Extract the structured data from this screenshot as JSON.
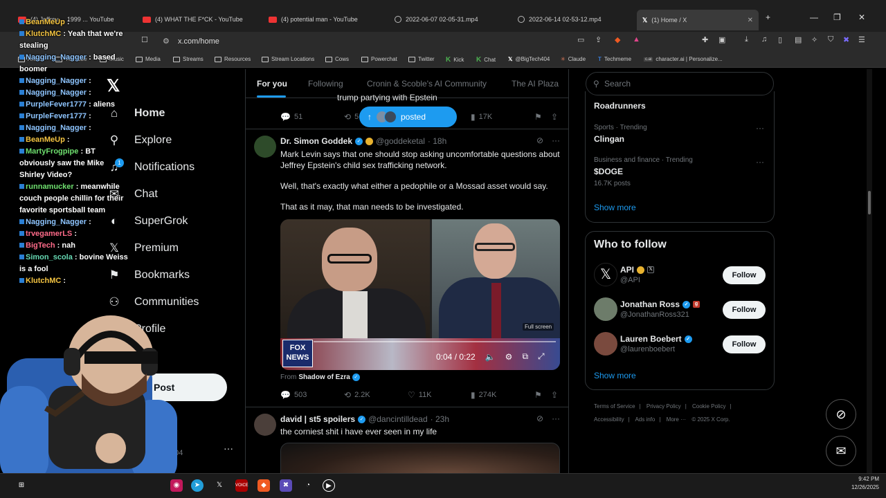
{
  "browser": {
    "tabs": [
      {
        "title": "(4) Jeffrey ... 1999 ... YouTube",
        "kind": "youtube"
      },
      {
        "title": "(4) WHAT THE F*CK - YouTube",
        "kind": "youtube"
      },
      {
        "title": "(4) potential man - YouTube",
        "kind": "youtube"
      },
      {
        "title": "2022-06-07 02-05-31.mp4",
        "kind": "video"
      },
      {
        "title": "2022-06-14 02-53-12.mp4",
        "kind": "video"
      },
      {
        "title": "(1) Home / X",
        "kind": "x",
        "active": true
      }
    ],
    "url": "x.com/home",
    "bookmarks": [
      "Artists",
      "YouTube",
      "Music",
      "Media",
      "Streams",
      "Resources",
      "Stream Locations",
      "Cows",
      "Powerchat",
      "Twitter",
      "Kick",
      "Chat",
      "@BigTech404",
      "Claude",
      "Techmeme",
      "character.ai | Personalize..."
    ]
  },
  "chat_overlay": [
    {
      "user": "BeanMeUp",
      "msg": "",
      "color": "u1"
    },
    {
      "user": "KlutchMC",
      "msg": "Yeah that we're stealing",
      "color": "u1"
    },
    {
      "user": "Nagging_Nagger",
      "msg": "based boomer",
      "color": "u2"
    },
    {
      "user": "Nagging_Nagger",
      "msg": "",
      "color": "u2"
    },
    {
      "user": "Nagging_Nagger",
      "msg": "",
      "color": "u2"
    },
    {
      "user": "PurpleFever1777",
      "msg": "aliens",
      "color": "u2"
    },
    {
      "user": "PurpleFever1777",
      "msg": "",
      "color": "u2"
    },
    {
      "user": "Nagging_Nagger",
      "msg": "",
      "color": "u2"
    },
    {
      "user": "BeanMeUp",
      "msg": "",
      "color": "u1"
    },
    {
      "user": "MartyFrogpipe",
      "msg": "BT obviously saw the Mike Shirley Video?",
      "color": "u3"
    },
    {
      "user": "runnamucker",
      "msg": "meanwhile couch people chillin for their favorite sportsball team",
      "color": "u3"
    },
    {
      "user": "Nagging_Nagger",
      "msg": "",
      "color": "u2"
    },
    {
      "user": "trvegamerLS",
      "msg": "",
      "color": "u4"
    },
    {
      "user": "BigTech",
      "msg": "nah",
      "color": "u4"
    },
    {
      "user": "Simon_scola",
      "msg": "bovine Weiss is a fool",
      "color": "u6"
    },
    {
      "user": "KlutchMC",
      "msg": "",
      "color": "u1"
    }
  ],
  "nav": {
    "items": [
      {
        "label": "Home",
        "icon": "home-icon"
      },
      {
        "label": "Explore",
        "icon": "search-icon"
      },
      {
        "label": "Notifications",
        "icon": "bell-icon"
      },
      {
        "label": "Chat",
        "icon": "mail-icon"
      },
      {
        "label": "SuperGrok",
        "icon": "grok-icon"
      },
      {
        "label": "Premium",
        "icon": "x-icon"
      },
      {
        "label": "Bookmarks",
        "icon": "bookmark-icon"
      },
      {
        "label": "Communities",
        "icon": "communities-icon"
      },
      {
        "label": "Profile",
        "icon": "profile-icon"
      }
    ],
    "notif_count": "1",
    "post_label": "Post",
    "account_handle": "404",
    "more": "···"
  },
  "timeline": {
    "tabs": [
      "For you",
      "Following",
      "Cronin & Scoble's AI Community",
      "The AI Plaza"
    ],
    "partial_text": "trump partying with Epstein",
    "prev_actions": {
      "replies": "51",
      "reposts": "5",
      "views": "17K"
    },
    "posted_pill": "posted",
    "post": {
      "name": "Dr. Simon Goddek",
      "handle": "@goddeketal",
      "time": "· 18h",
      "paragraphs": [
        "Mark Levin says that one should stop asking uncomfortable questions about Jeffrey Epstein's child sex trafficking network.",
        "Well, that's exactly what either a pedophile or a Mossad asset would say.",
        "That as it may, that man needs to be investigated."
      ],
      "video_time": "0:04 / 0:22",
      "fullscreen": "Full screen",
      "fox_label": "FOX NEWS",
      "from_prefix": "From",
      "from_source": "Shadow of Ezra",
      "actions": {
        "replies": "503",
        "reposts": "2.2K",
        "likes": "11K",
        "views": "274K"
      }
    },
    "post2": {
      "name": "david | st5 spoilers",
      "handle": "@dancintilldead",
      "time": "· 23h",
      "text": "the corniest shit i have ever seen in my life"
    }
  },
  "right": {
    "search_placeholder": "Search",
    "trends": [
      {
        "category": "",
        "name": "Roadrunners",
        "posts": ""
      },
      {
        "category": "Sports · Trending",
        "name": "Clingan",
        "posts": ""
      },
      {
        "category": "Business and finance · Trending",
        "name": "$DOGE",
        "posts": "16.7K posts"
      }
    ],
    "show_more": "Show more",
    "who_to_follow_title": "Who to follow",
    "follow_suggestions": [
      {
        "name": "API",
        "handle": "@API",
        "follow": "Follow"
      },
      {
        "name": "Jonathan Ross",
        "handle": "@JonathanRoss321",
        "follow": "Follow"
      },
      {
        "name": "Lauren Boebert",
        "handle": "@laurenboebert",
        "follow": "Follow"
      }
    ],
    "show_more_2": "Show more",
    "footer": [
      "Terms of Service",
      "|",
      "Privacy Policy",
      "|",
      "Cookie Policy",
      "|",
      "Accessibility",
      "|",
      "Ads info",
      "|",
      "More ···",
      "© 2025 X Corp."
    ]
  },
  "taskbar": {
    "time": "9:42 PM",
    "date": "12/26/2025"
  },
  "colors": {
    "accent": "#1d9bf0",
    "bg": "#000000",
    "muted": "#71767b"
  }
}
